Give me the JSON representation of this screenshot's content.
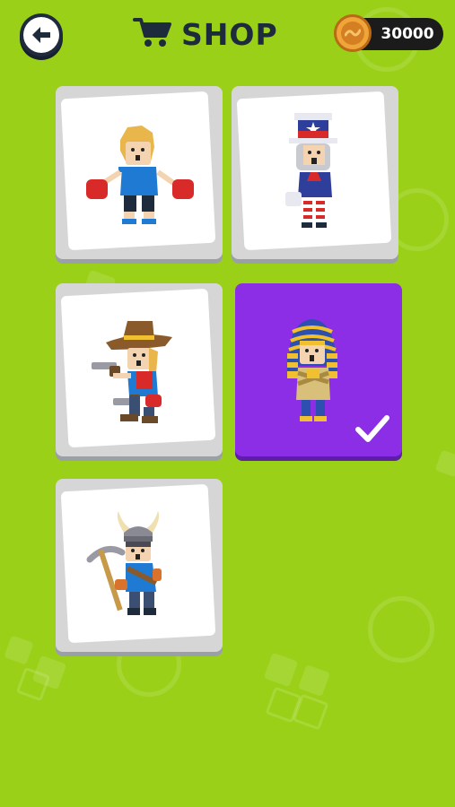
{
  "header": {
    "title": "SHOP",
    "coins": "30000"
  },
  "icons": {
    "back": "back-arrow-icon",
    "cart": "shopping-cart-icon",
    "coin": "coin-icon",
    "check": "checkmark-icon"
  },
  "colors": {
    "background": "#9ad118",
    "selected_card": "#8b2ee6",
    "card_face": "#ffffff",
    "dark": "#1e2b3c"
  },
  "shop": {
    "items": [
      {
        "character": "boxer",
        "selected": false
      },
      {
        "character": "uncle-sam",
        "selected": false
      },
      {
        "character": "cowboy",
        "selected": false
      },
      {
        "character": "pharaoh",
        "selected": true
      },
      {
        "character": "viking",
        "selected": false
      }
    ]
  }
}
